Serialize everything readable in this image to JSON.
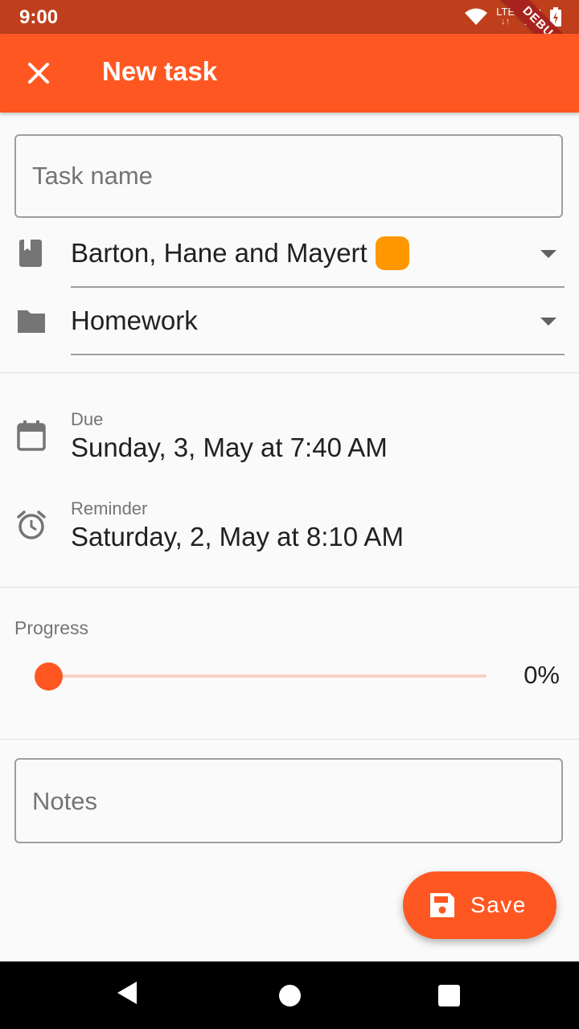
{
  "status_bar": {
    "time": "9:00",
    "network": "LTE",
    "debug_label": "DEBUG"
  },
  "app_bar": {
    "title": "New task",
    "close_icon": "close-icon"
  },
  "form": {
    "task_name": {
      "placeholder": "Task name",
      "value": ""
    },
    "course": {
      "icon": "book-icon",
      "value": "Barton, Hane and Mayert",
      "color": "#ff9800"
    },
    "category": {
      "icon": "folder-icon",
      "value": "Homework"
    },
    "due": {
      "icon": "calendar-icon",
      "label": "Due",
      "value": "Sunday, 3, May at 7:40 AM"
    },
    "reminder": {
      "icon": "alarm-icon",
      "label": "Reminder",
      "value": "Saturday, 2, May at 8:10 AM"
    },
    "progress": {
      "label": "Progress",
      "value": 0,
      "display": "0%"
    },
    "notes": {
      "placeholder": "Notes",
      "value": ""
    }
  },
  "fab": {
    "label": "Save",
    "icon": "save-icon"
  },
  "colors": {
    "primary": "#ff5722",
    "status_bar": "#bf3f1c",
    "course_color": "#ff9800"
  }
}
